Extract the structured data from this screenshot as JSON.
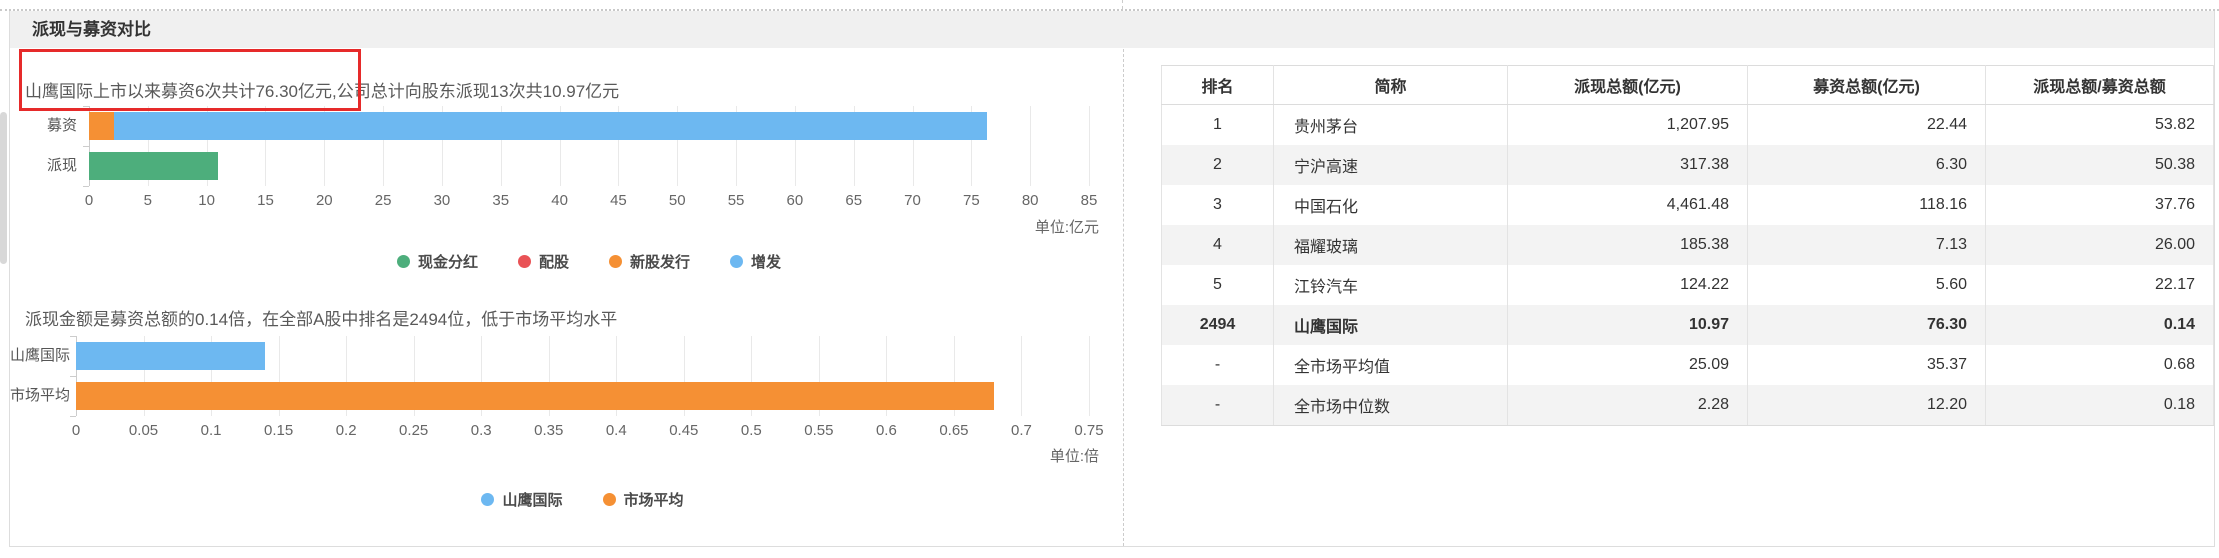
{
  "window": {
    "title_bar": {
      "title": "派现与募资对比"
    }
  },
  "summaries": {
    "line1": "山鹰国际上市以来募资6次共计76.30亿元,公司总计向股东派现13次共10.97亿元",
    "line2": "派现金额是募资总额的0.14倍，在全部A股中排名是2494位，低于市场平均水平"
  },
  "annotation": {
    "box_color": "#e62a2a"
  },
  "colors": {
    "blue": "#6DB8F1",
    "orange": "#F59034",
    "green": "#4DAE7C",
    "red": "#E95256"
  },
  "chart_data": [
    {
      "type": "bar",
      "orientation": "horizontal",
      "categories": [
        "募资",
        "派现"
      ],
      "bars": [
        {
          "category": "募资",
          "segments": [
            {
              "name": "新股发行",
              "value": 2.1,
              "color": "#F59034"
            },
            {
              "name": "增发",
              "value": 74.2,
              "color": "#6DB8F1"
            }
          ],
          "total": 76.3
        },
        {
          "category": "派现",
          "segments": [
            {
              "name": "现金分红",
              "value": 10.97,
              "color": "#4DAE7C"
            }
          ],
          "total": 10.97
        }
      ],
      "xlim": [
        0,
        85
      ],
      "ticks": [
        "0",
        "5",
        "10",
        "15",
        "20",
        "25",
        "30",
        "35",
        "40",
        "45",
        "50",
        "55",
        "60",
        "65",
        "70",
        "75",
        "80",
        "85"
      ],
      "unit_label": "单位:亿元",
      "grid": true,
      "legend_position": "bottom-center",
      "legend": [
        {
          "label": "现金分红",
          "color": "#4DAE7C"
        },
        {
          "label": "配股",
          "color": "#E95256"
        },
        {
          "label": "新股发行",
          "color": "#F59034"
        },
        {
          "label": "增发",
          "color": "#6DB8F1"
        }
      ]
    },
    {
      "type": "bar",
      "orientation": "horizontal",
      "categories": [
        "山鹰国际",
        "市场平均"
      ],
      "bars": [
        {
          "category": "山鹰国际",
          "segments": [
            {
              "name": "山鹰国际",
              "value": 0.14,
              "color": "#6DB8F1"
            }
          ],
          "total": 0.14
        },
        {
          "category": "市场平均",
          "segments": [
            {
              "name": "市场平均",
              "value": 0.68,
              "color": "#F59034"
            }
          ],
          "total": 0.68
        }
      ],
      "xlim": [
        0,
        0.75
      ],
      "ticks": [
        "0",
        "0.05",
        "0.1",
        "0.15",
        "0.2",
        "0.25",
        "0.3",
        "0.35",
        "0.4",
        "0.45",
        "0.5",
        "0.55",
        "0.6",
        "0.65",
        "0.7",
        "0.75"
      ],
      "unit_label": "单位:倍",
      "grid": true,
      "legend_position": "bottom-center",
      "legend": [
        {
          "label": "山鹰国际",
          "color": "#6DB8F1"
        },
        {
          "label": "市场平均",
          "color": "#F59034"
        }
      ]
    }
  ],
  "table": {
    "headers": [
      "排名",
      "简称",
      "派现总额(亿元)",
      "募资总额(亿元)",
      "派现总额/募资总额"
    ],
    "rows": [
      [
        "1",
        "贵州茅台",
        "1,207.95",
        "22.44",
        "53.82"
      ],
      [
        "2",
        "宁沪高速",
        "317.38",
        "6.30",
        "50.38"
      ],
      [
        "3",
        "中国石化",
        "4,461.48",
        "118.16",
        "37.76"
      ],
      [
        "4",
        "福耀玻璃",
        "185.38",
        "7.13",
        "26.00"
      ],
      [
        "5",
        "江铃汽车",
        "124.22",
        "5.60",
        "22.17"
      ],
      [
        "2494",
        "山鹰国际",
        "10.97",
        "76.30",
        "0.14"
      ],
      [
        "-",
        "全市场平均值",
        "25.09",
        "35.37",
        "0.68"
      ],
      [
        "-",
        "全市场中位数",
        "2.28",
        "12.20",
        "0.18"
      ]
    ],
    "highlight_rank": "2494"
  }
}
